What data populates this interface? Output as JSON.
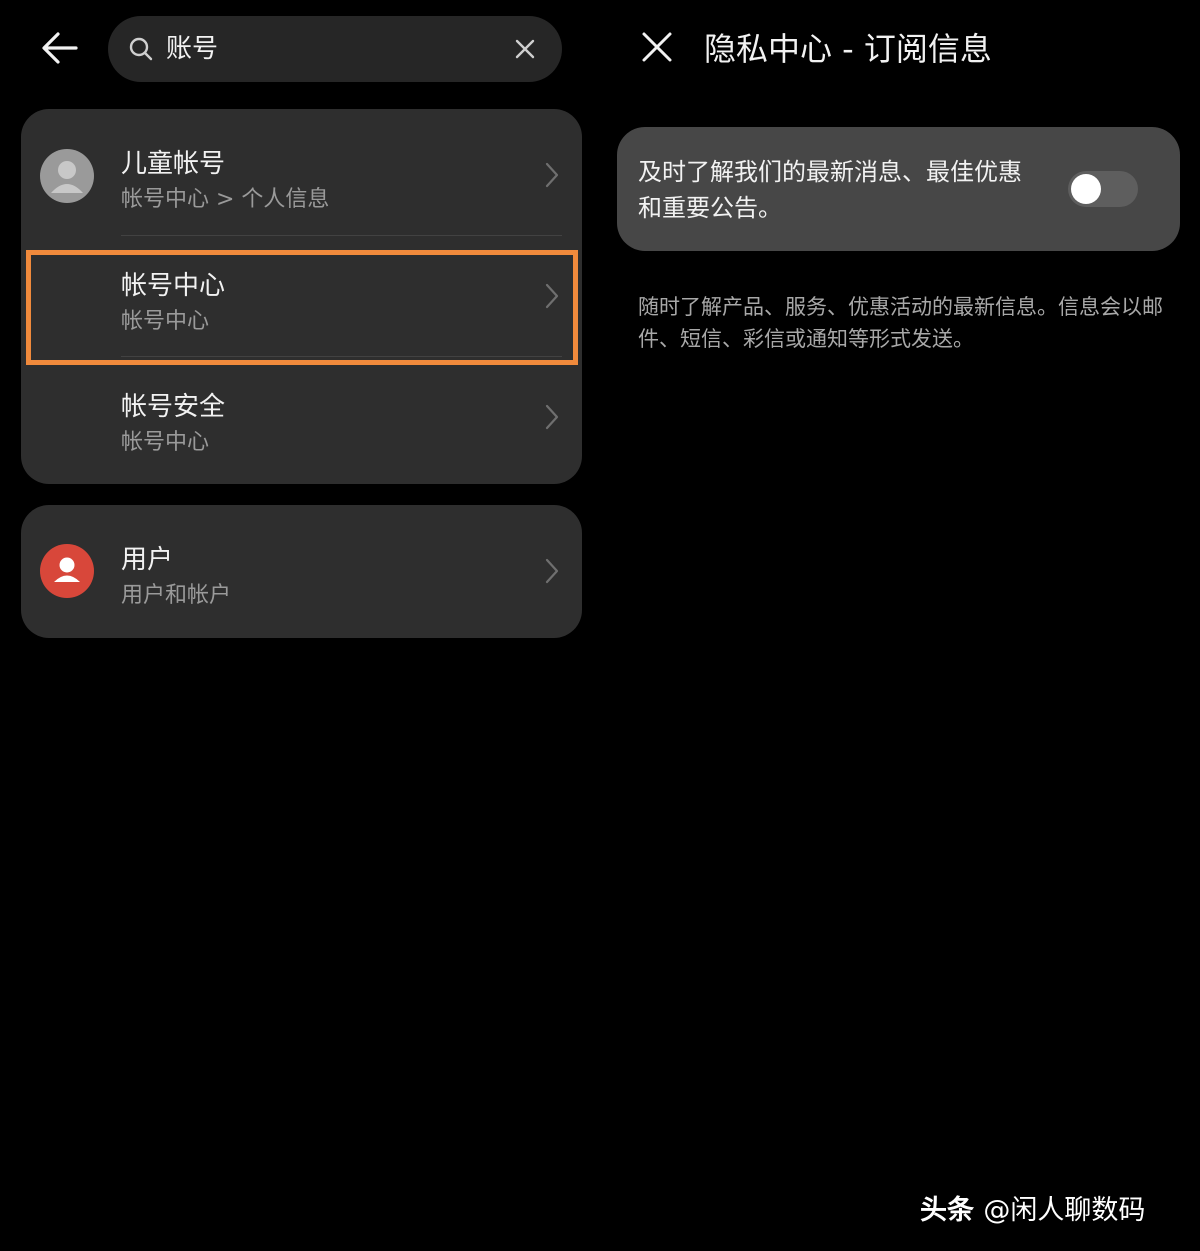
{
  "search": {
    "value": "账号",
    "clear_label": "clear"
  },
  "results": {
    "group1": [
      {
        "title": "儿童帐号",
        "subtitle": "帐号中心 > 个人信息",
        "avatar": "person-avatar-gray"
      },
      {
        "title": "帐号中心",
        "subtitle": "帐号中心",
        "highlighted": true
      },
      {
        "title": "帐号安全",
        "subtitle": "帐号中心"
      }
    ],
    "group2": [
      {
        "title": "用户",
        "subtitle": "用户和帐户",
        "avatar": "person-avatar-red"
      }
    ]
  },
  "detail": {
    "title": "隐私中心 - 订阅信息",
    "toggle_label": "及时了解我们的最新消息、最佳优惠和重要公告。",
    "toggle_on": false,
    "description": "随时了解产品、服务、优惠活动的最新信息。信息会以邮件、短信、彩信或通知等形式发送。"
  },
  "watermark": {
    "brand": "头条",
    "handle": "@闲人聊数码"
  },
  "colors": {
    "background": "#000000",
    "card": "#2e2e2e",
    "toggle_card": "#474747",
    "highlight": "#f08a3c",
    "avatar_gray": "#9a9a9a",
    "avatar_red": "#d8473a"
  }
}
